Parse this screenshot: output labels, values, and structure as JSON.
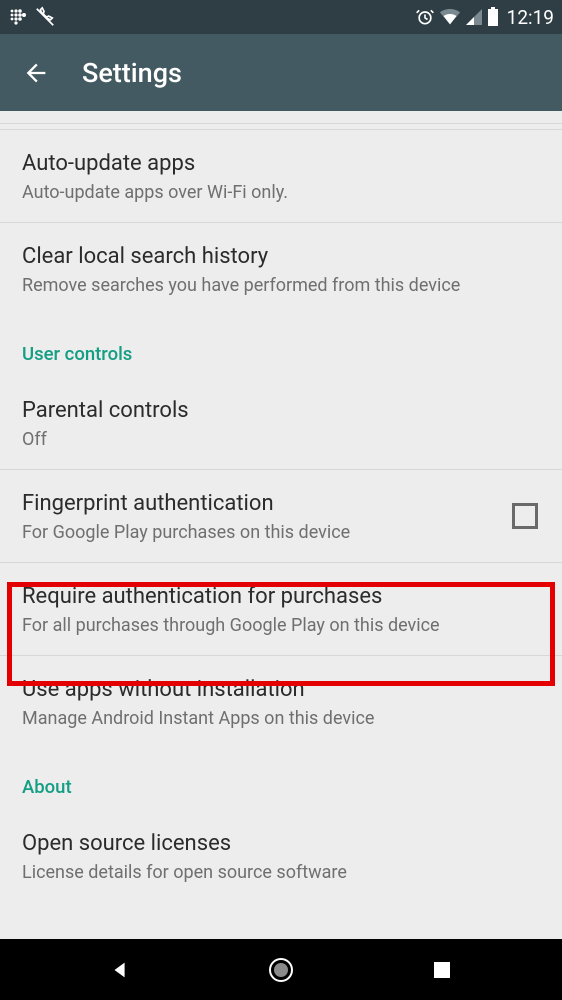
{
  "statusbar": {
    "time": "12:19"
  },
  "appbar": {
    "title": "Settings"
  },
  "items": {
    "auto_update": {
      "title": "Auto-update apps",
      "sub": "Auto-update apps over Wi-Fi only."
    },
    "clear_history": {
      "title": "Clear local search history",
      "sub": "Remove searches you have performed from this device"
    },
    "parental": {
      "title": "Parental controls",
      "sub": "Off"
    },
    "fingerprint": {
      "title": "Fingerprint authentication",
      "sub": "For Google Play purchases on this device"
    },
    "require_auth": {
      "title": "Require authentication for purchases",
      "sub": "For all purchases through Google Play on this device"
    },
    "instant_apps": {
      "title": "Use apps without installation",
      "sub": "Manage Android Instant Apps on this device"
    },
    "open_source": {
      "title": "Open source licenses",
      "sub": "License details for open source software"
    }
  },
  "sections": {
    "user_controls": "User controls",
    "about": "About"
  }
}
